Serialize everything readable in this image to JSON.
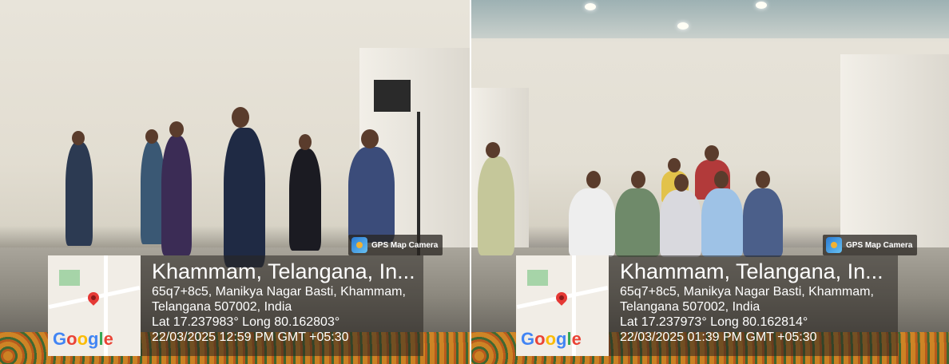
{
  "photos": [
    {
      "badge": "GPS Map Camera",
      "place": "Khammam, Telangana, In...",
      "address1": "65q7+8c5, Manikya Nagar Basti, Khammam,",
      "address2": "Telangana 507002, India",
      "coords": "Lat 17.237983° Long 80.162803°",
      "datetime": "22/03/2025 12:59 PM GMT +05:30",
      "map_logo": "Google"
    },
    {
      "badge": "GPS Map Camera",
      "place": "Khammam, Telangana, In...",
      "address1": "65q7+8c5, Manikya Nagar Basti, Khammam,",
      "address2": "Telangana 507002, India",
      "coords": "Lat 17.237973° Long 80.162814°",
      "datetime": "22/03/2025 01:39 PM GMT +05:30",
      "map_logo": "Google"
    }
  ],
  "icons": [
    "map-pin-icon",
    "gps-camera-icon"
  ]
}
